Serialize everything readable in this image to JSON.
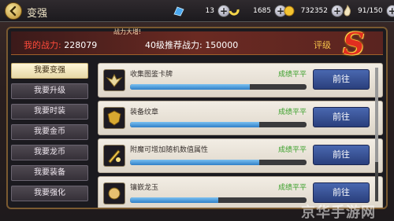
{
  "header": {
    "title": "变强",
    "back_icon": "back-arrow-icon",
    "resources": [
      {
        "icon": "blue-crystal-icon",
        "value": "13"
      },
      {
        "icon": "yellow-horn-icon",
        "value": "1685"
      },
      {
        "icon": "gold-coin-icon",
        "value": "732352"
      },
      {
        "icon": "stamina-flame-icon",
        "value": "91/150"
      }
    ]
  },
  "power": {
    "mine_label": "我的战力:",
    "mine_value": "228079",
    "recommend_label": "40级推荐战力:",
    "recommend_value": "150000",
    "notice": "战力大增!",
    "grade_label": "评级",
    "grade": "S"
  },
  "sidebar": {
    "items": [
      {
        "label": "我要变强",
        "active": true
      },
      {
        "label": "我要升级",
        "active": false
      },
      {
        "label": "我要时装",
        "active": false
      },
      {
        "label": "我要金币",
        "active": false
      },
      {
        "label": "我要龙币",
        "active": false
      },
      {
        "label": "我要装备",
        "active": false
      },
      {
        "label": "我要强化",
        "active": false
      }
    ]
  },
  "list": {
    "items": [
      {
        "name": "收集图鉴卡牌",
        "status": "成绩平平",
        "button": "前往",
        "progress": 0.68,
        "icon": "card-wing-icon"
      },
      {
        "name": "装备纹章",
        "status": "成绩平平",
        "button": "前往",
        "progress": 0.73,
        "icon": "shield-emblem-icon"
      },
      {
        "name": "附魔可增加随机数值属性",
        "status": "成绩平平",
        "button": "前往",
        "progress": 0.73,
        "icon": "enchant-sword-icon"
      },
      {
        "name": "镶嵌龙玉",
        "status": "成绩平平",
        "button": "前往",
        "progress": 0.5,
        "icon": "dragon-jade-icon"
      }
    ]
  },
  "watermark": "京华手游网",
  "colors": {
    "status_green": "#3aa02a",
    "go_button": "#3a53a0",
    "power_red": "#ff4a3a",
    "grade_red": "#e12e20"
  }
}
